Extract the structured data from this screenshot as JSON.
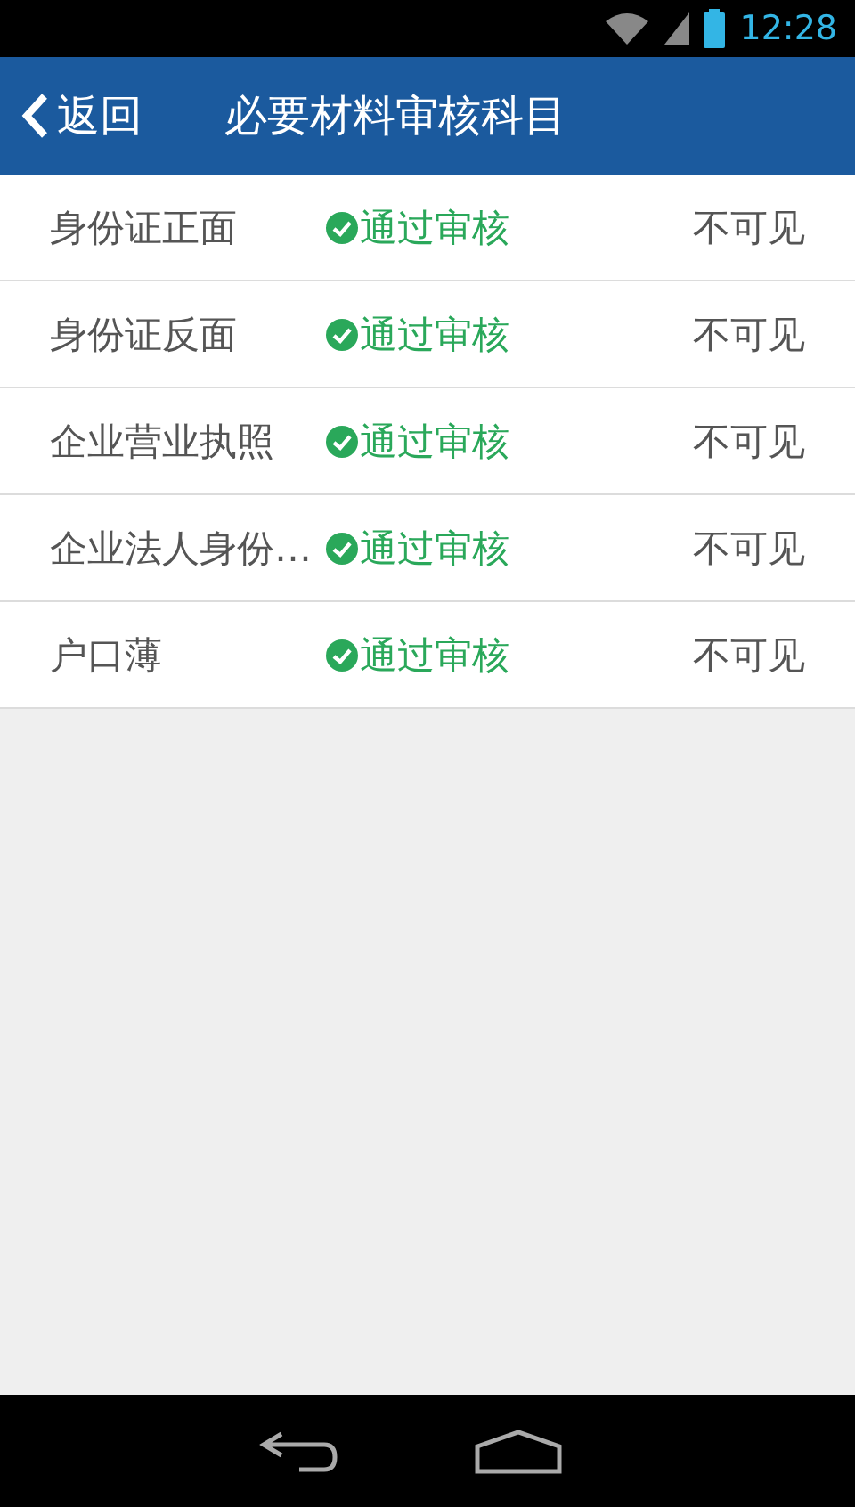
{
  "status_bar": {
    "time": "12:28"
  },
  "header": {
    "back_label": "返回",
    "title": "必要材料审核科目"
  },
  "rows": [
    {
      "name": "身份证正面",
      "status": "通过审核",
      "visibility": "不可见"
    },
    {
      "name": "身份证反面",
      "status": "通过审核",
      "visibility": "不可见"
    },
    {
      "name": "企业营业执照",
      "status": "通过审核",
      "visibility": "不可见"
    },
    {
      "name": "企业法人身份…",
      "status": "通过审核",
      "visibility": "不可见"
    },
    {
      "name": "户口薄",
      "status": "通过审核",
      "visibility": "不可见"
    }
  ]
}
